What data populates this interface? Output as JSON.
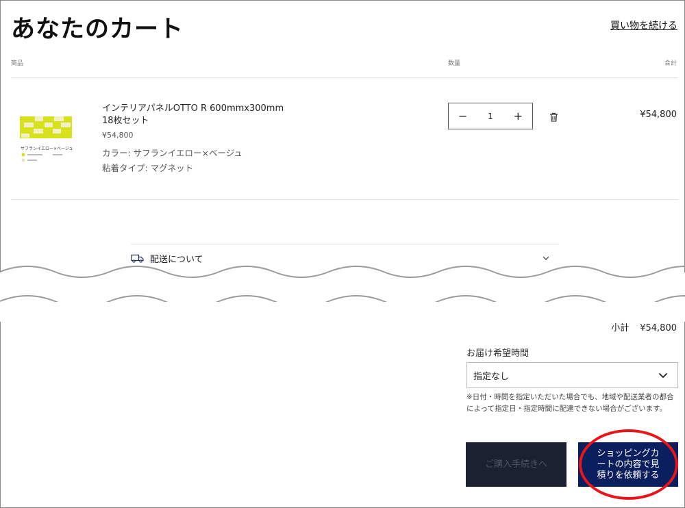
{
  "header": {
    "title": "あなたのカート",
    "continue_link": "買い物を続ける"
  },
  "table": {
    "col_product": "商品",
    "col_qty": "数量",
    "col_total": "合計"
  },
  "item": {
    "name": "インテリアパネルOTTO R 600mmx300mm 18枚セット",
    "unit_price": "¥54,800",
    "option_color": "カラー: サフランイエロー×ベージュ",
    "option_adhesive": "粘着タイプ: マグネット",
    "quantity": "1",
    "line_total": "¥54,800",
    "thumb_label": "サフランイエロー×ベージュ"
  },
  "shipping": {
    "label": "配送について"
  },
  "summary": {
    "subtotal_label": "小計",
    "subtotal_value": "¥54,800",
    "delivery_label": "お届け希望時間",
    "delivery_selected": "指定なし",
    "note": "※日付・時間を指定いただいた場合でも、地域や配送業者の都合によって指定日・指定時間に配達できない場合がございます。",
    "checkout_label": "ご購入手続きへ",
    "quote_label": "ショッピングカートの内容で見積りを依頼する"
  },
  "colors": {
    "accent_navy": "#0b1f5e",
    "disabled_dark": "#1b2130",
    "highlight_red": "#e8151b"
  },
  "icons": {
    "trash": "trash-icon",
    "truck": "truck-icon",
    "chevron": "chevron-down-icon"
  }
}
